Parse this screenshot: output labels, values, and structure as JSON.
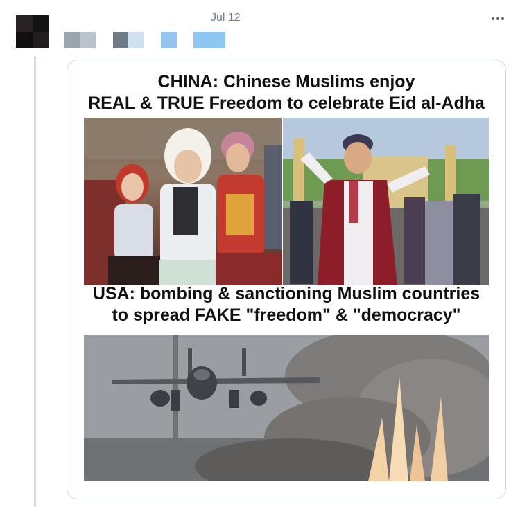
{
  "tweet": {
    "timestamp": "Jul 12",
    "more_icon": "more-horizontal-icon",
    "handle_blocks": [
      "#9aa4ae",
      "#b9c3cc",
      "#6f7b86",
      "#cfe0f0",
      "#93c4ee",
      "#8ec8f2"
    ]
  },
  "card": {
    "headline_top_line1": "CHINA: Chinese Muslims enjoy",
    "headline_top_line2": "REAL & TRUE Freedom to celebrate Eid al-Adha",
    "headline_bottom_line1": "USA: bombing & sanctioning Muslim countries",
    "headline_bottom_line2": "to spread FAKE \"freedom\" & \"democracy\""
  },
  "colors": {
    "timestamp": "#6a7d9a",
    "thread_line": "#cfd9de",
    "card_border": "#cfd9de"
  }
}
